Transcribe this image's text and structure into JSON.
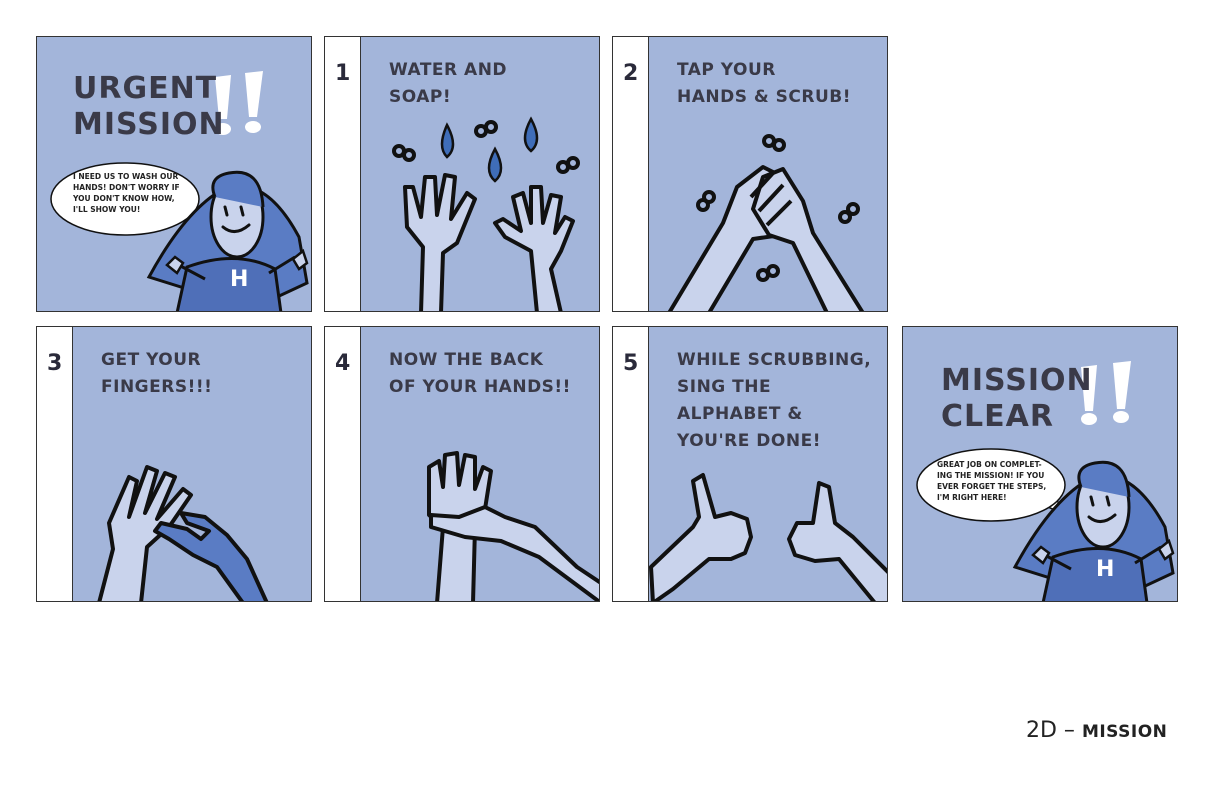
{
  "panels": {
    "intro": {
      "title": "URGENT\nMISSION",
      "speech": "I need us to wash our\nhands! Don't worry if\nyou don't know how,\nI'll show you!",
      "shirt_letter": "H"
    },
    "step1": {
      "number": "1",
      "caption": "WATER AND\nSOAP!"
    },
    "step2": {
      "number": "2",
      "caption": "TAP YOUR\nHANDS & SCRUB!"
    },
    "step3": {
      "number": "3",
      "caption": "GET YOUR\nFINGERS!!!"
    },
    "step4": {
      "number": "4",
      "caption": "NOW THE BACK\nOF YOUR HANDS!!"
    },
    "step5": {
      "number": "5",
      "caption": "WHILE SCRUBBING,\nSING THE\nALPHABET &\nYOU'RE DONE!"
    },
    "outro": {
      "title": "MISSION\nCLEAR",
      "speech": "Great job on complet-\ning the mission! If you\never forget the steps,\nI'm right here!",
      "shirt_letter": "H"
    }
  },
  "footer": {
    "label_main": "2D – ",
    "label_small": "MISSION"
  },
  "colors": {
    "panel_bg": "#a3b5da",
    "skin": "#c9d3ec",
    "shirt": "#5a7cc4",
    "droplet": "#3f6db8",
    "outline": "#111111",
    "exclamation": "#ffffff"
  }
}
